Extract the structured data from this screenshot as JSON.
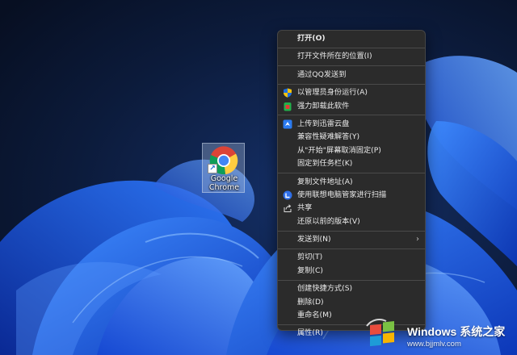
{
  "desktop": {
    "icon_label_line1": "Google",
    "icon_label_line2": "Chrome"
  },
  "context_menu": {
    "items": [
      {
        "label": "打开(O)",
        "bold": true
      },
      {
        "label": "打开文件所在的位置(I)"
      },
      {
        "label": "通过QQ发送到"
      },
      {
        "label": "以管理员身份运行(A)",
        "icon": "uac-shield-icon"
      },
      {
        "label": "强力卸载此软件",
        "icon": "uninstall-icon"
      },
      {
        "label": "上传到迅雷云盘",
        "icon": "xunlei-bird-icon"
      },
      {
        "label": "兼容性疑难解答(Y)"
      },
      {
        "label": "从\"开始\"屏幕取消固定(P)"
      },
      {
        "label": "固定到任务栏(K)"
      },
      {
        "label": "复制文件地址(A)"
      },
      {
        "label": "使用联想电脑管家进行扫描",
        "icon": "lenovo-manager-icon"
      },
      {
        "label": "共享",
        "icon": "share-icon"
      },
      {
        "label": "还原以前的版本(V)"
      },
      {
        "label": "发送到(N)",
        "submenu": true
      },
      {
        "label": "剪切(T)"
      },
      {
        "label": "复制(C)"
      },
      {
        "label": "创建快捷方式(S)"
      },
      {
        "label": "删除(D)"
      },
      {
        "label": "重命名(M)"
      },
      {
        "label": "属性(R)"
      }
    ]
  },
  "watermark": {
    "title": "Windows 系统之家",
    "url": "www.bjjmlv.com"
  },
  "colors": {
    "menu_bg": "#2b2b2b",
    "menu_text": "#eaeaea",
    "wallpaper_dark": "#0b1730",
    "bloom_blue": "#1f63e6"
  }
}
